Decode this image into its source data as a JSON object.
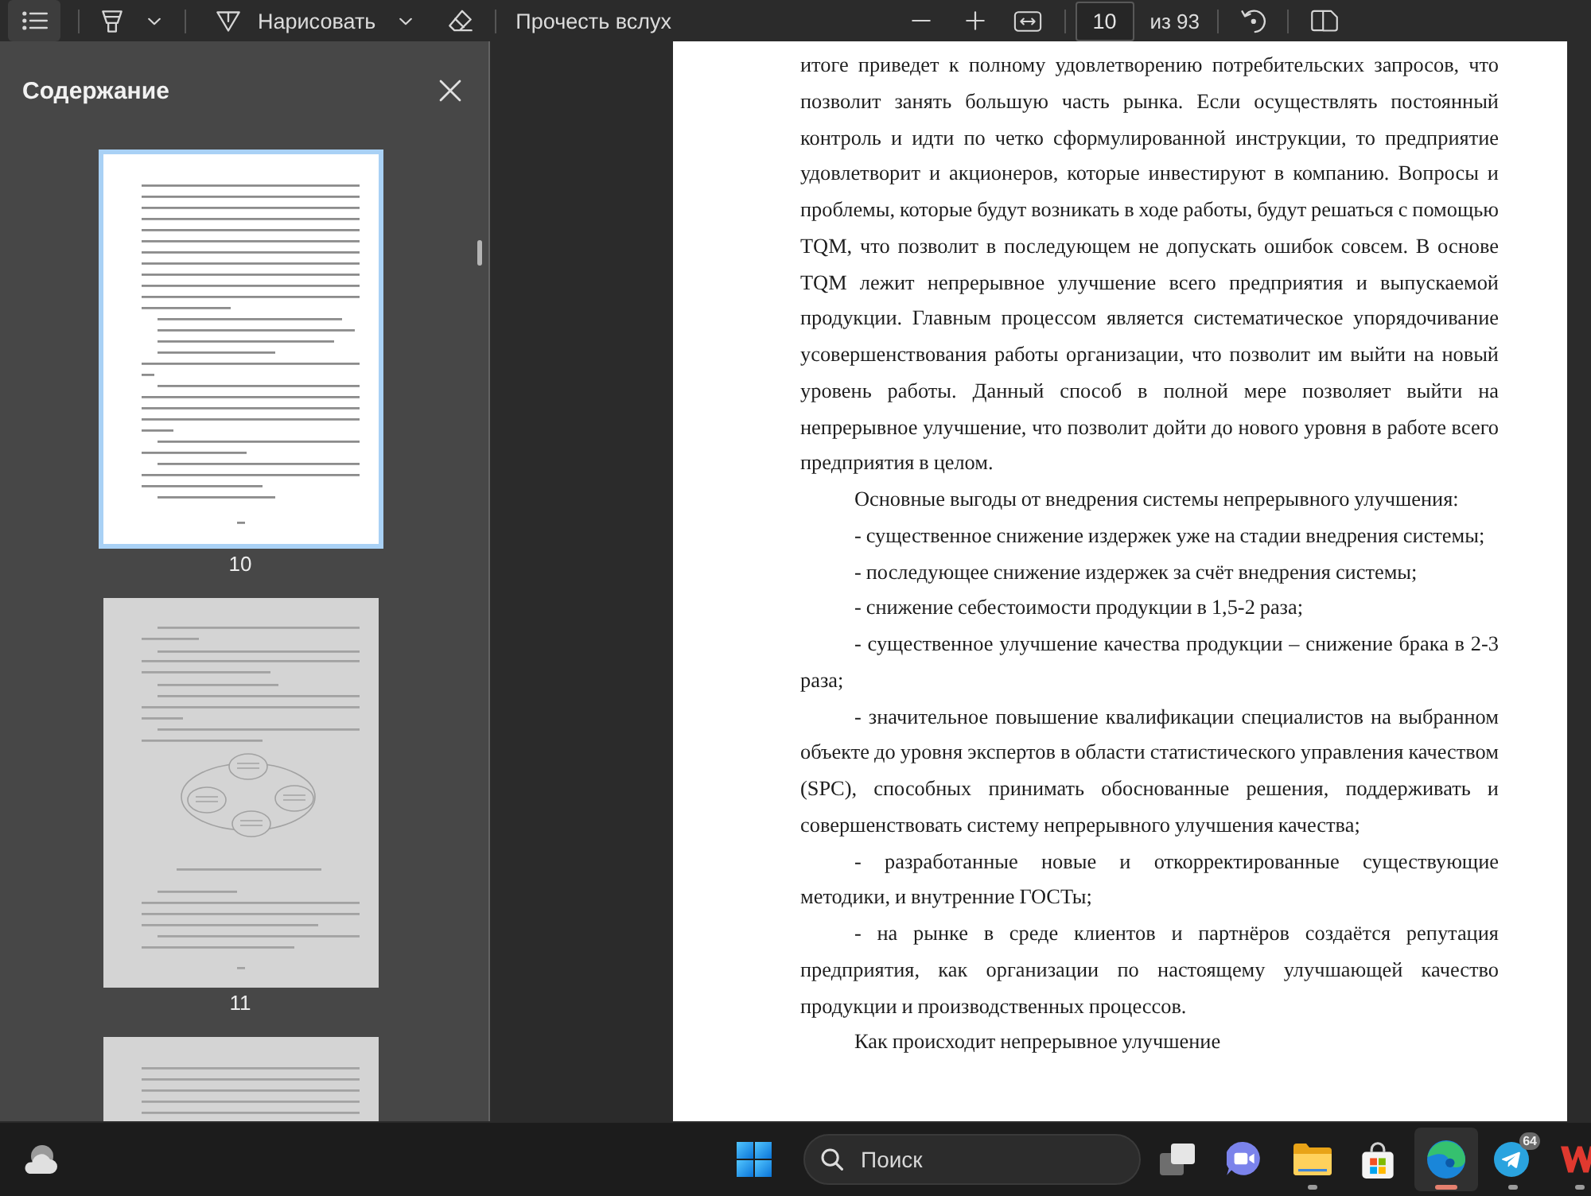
{
  "toolbar": {
    "contents_toggle": {
      "on": true
    },
    "draw_button": {
      "label": "Нарисовать"
    },
    "read_aloud_button": {
      "label": "Прочесть вслух"
    },
    "page_field": {
      "value": "10"
    },
    "page_count": "из 93"
  },
  "sidebar": {
    "title": "Содержание",
    "thumbnails": [
      {
        "label": "10",
        "kind": "text",
        "selected": true
      },
      {
        "label": "11",
        "kind": "figure",
        "selected": false
      },
      {
        "kind": "text",
        "selected": false
      }
    ]
  },
  "document": {
    "paragraphs": [
      {
        "text": "итоге приведет к полному удовлетворению потребительских запросов, что позволит занять большую часть рынка. Если осуществлять постоянный контроль и идти по четко сформулированной инструкции, то предприятие удовлетворит и акционеров, которые инвестируют в компанию. Вопросы и проблемы, которые будут возникать в ходе работы, будут решаться с помощью TQM, что позволит в последующем не допускать ошибок совсем. В основе TQM лежит непрерывное улучшение всего предприятия и выпускаемой продукции. Главным процессом является систематическое упорядочивание усовершенствования работы организации, что позволит им выйти на новый уровень работы. Данный способ в полной мере позволяет выйти на непрерывное улучшение, что позволит дойти до нового уровня в работе всего предприятия в целом.",
        "indent": false
      },
      {
        "text": "Основные выгоды от внедрения системы непрерывного улучшения:",
        "indent": true
      },
      {
        "text": "- существенное снижение издержек уже на стадии внедрения системы;",
        "indent": true
      },
      {
        "text": "- последующее снижение издержек за счёт внедрения системы;",
        "indent": true
      },
      {
        "text": "- снижение себестоимости продукции в 1,5-2 раза;",
        "indent": true
      },
      {
        "text": "- существенное улучшение качества продукции – снижение брака в 2-3 раза;",
        "indent": true
      },
      {
        "text": "- значительное повышение квалификации специалистов на выбранном объекте до уровня экспертов в области статистического управления качеством (SPC), способных принимать обоснованные решения, поддерживать и совершенствовать систему непрерывного улучшения качества;",
        "indent": true
      },
      {
        "text": "- разработанные новые и откорректированные существующие методики, и внутренние ГОСТы;",
        "indent": true
      },
      {
        "text": "- на рынке в среде клиентов и партнёров создаётся репутация предприятия, как организации по настоящему улучшающей качество продукции и производственных процессов.",
        "indent": true
      },
      {
        "text": "Как происходит непрерывное улучшение",
        "indent": true
      }
    ]
  },
  "taskbar": {
    "search": {
      "placeholder": "Поиск"
    },
    "apps": [
      {
        "kind": "task-view",
        "running": false,
        "active": false
      },
      {
        "kind": "meet",
        "running": false,
        "active": false
      },
      {
        "kind": "files",
        "running": true,
        "active": false
      },
      {
        "kind": "store",
        "running": false,
        "active": false
      },
      {
        "kind": "browser",
        "running": true,
        "active": true
      },
      {
        "kind": "messenger",
        "running": true,
        "active": false,
        "badge": "64"
      },
      {
        "kind": "zigzag",
        "running": true,
        "active": false
      }
    ]
  }
}
